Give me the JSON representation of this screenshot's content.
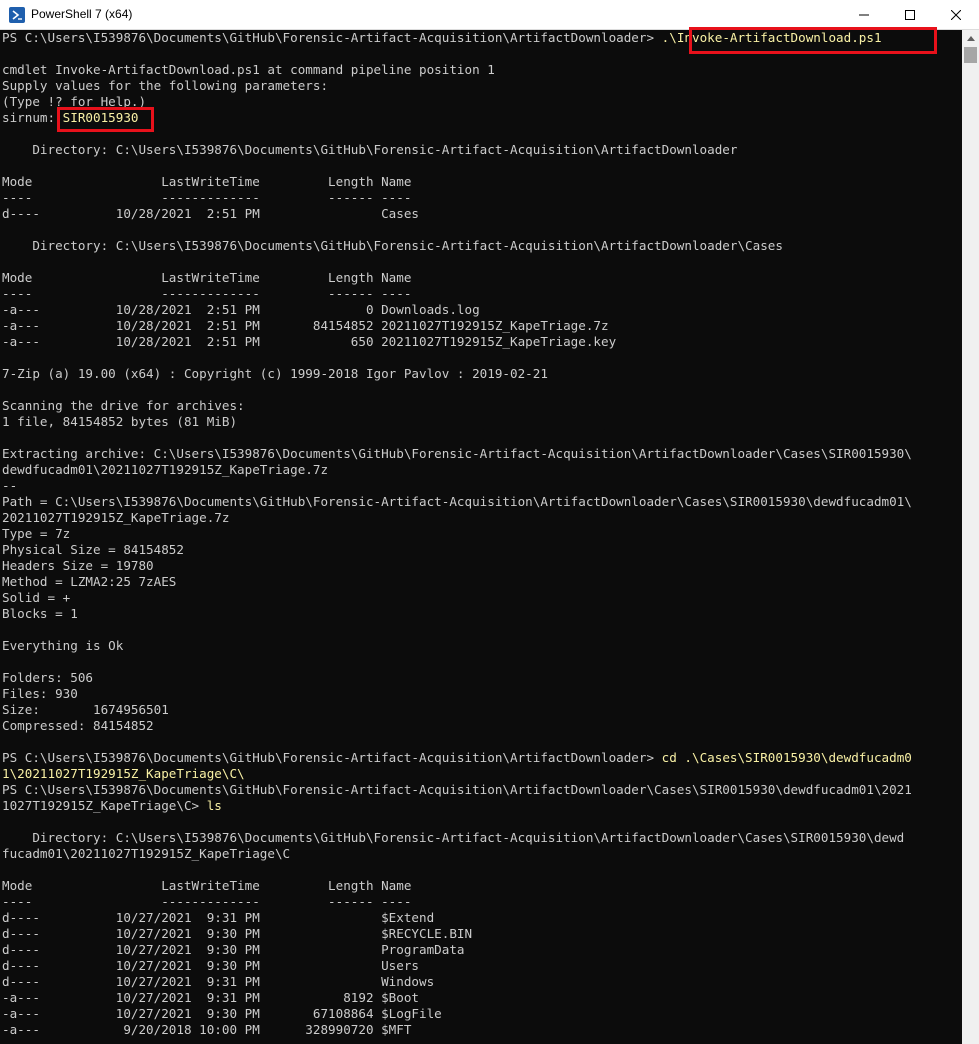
{
  "window": {
    "title": "PowerShell 7 (x64)",
    "icon": "powershell-icon",
    "controls": [
      "minimize-icon",
      "maximize-icon",
      "close-icon"
    ]
  },
  "colors": {
    "console_bg": "#0c0c0c",
    "console_fg": "#cccccc",
    "command_fg": "#f9f1a5",
    "highlight_box": "#e8111b"
  },
  "console": {
    "lines": [
      {
        "text": "PS C:\\Users\\I539876\\Documents\\GitHub\\Forensic-Artifact-Acquisition\\ArtifactDownloader> ",
        "cmd": ".\\Invoke-ArtifactDownload.ps1"
      },
      {
        "text": ""
      },
      {
        "text": "cmdlet Invoke-ArtifactDownload.ps1 at command pipeline position 1"
      },
      {
        "text": "Supply values for the following parameters:"
      },
      {
        "text": "(Type !? for Help.)"
      },
      {
        "text": "sirnum: ",
        "cmd": "SIR0015930"
      },
      {
        "text": ""
      },
      {
        "text": "    Directory: C:\\Users\\I539876\\Documents\\GitHub\\Forensic-Artifact-Acquisition\\ArtifactDownloader"
      },
      {
        "text": ""
      },
      {
        "text": "Mode                 LastWriteTime         Length Name"
      },
      {
        "text": "----                 -------------         ------ ----"
      },
      {
        "text": "d----          10/28/2021  2:51 PM                Cases"
      },
      {
        "text": ""
      },
      {
        "text": "    Directory: C:\\Users\\I539876\\Documents\\GitHub\\Forensic-Artifact-Acquisition\\ArtifactDownloader\\Cases"
      },
      {
        "text": ""
      },
      {
        "text": "Mode                 LastWriteTime         Length Name"
      },
      {
        "text": "----                 -------------         ------ ----"
      },
      {
        "text": "-a---          10/28/2021  2:51 PM              0 Downloads.log"
      },
      {
        "text": "-a---          10/28/2021  2:51 PM       84154852 20211027T192915Z_KapeTriage.7z"
      },
      {
        "text": "-a---          10/28/2021  2:51 PM            650 20211027T192915Z_KapeTriage.key"
      },
      {
        "text": ""
      },
      {
        "text": "7-Zip (a) 19.00 (x64) : Copyright (c) 1999-2018 Igor Pavlov : 2019-02-21"
      },
      {
        "text": ""
      },
      {
        "text": "Scanning the drive for archives:"
      },
      {
        "text": "1 file, 84154852 bytes (81 MiB)"
      },
      {
        "text": ""
      },
      {
        "text": "Extracting archive: C:\\Users\\I539876\\Documents\\GitHub\\Forensic-Artifact-Acquisition\\ArtifactDownloader\\Cases\\SIR0015930\\"
      },
      {
        "text": "dewdfucadm01\\20211027T192915Z_KapeTriage.7z"
      },
      {
        "text": "--"
      },
      {
        "text": "Path = C:\\Users\\I539876\\Documents\\GitHub\\Forensic-Artifact-Acquisition\\ArtifactDownloader\\Cases\\SIR0015930\\dewdfucadm01\\"
      },
      {
        "text": "20211027T192915Z_KapeTriage.7z"
      },
      {
        "text": "Type = 7z"
      },
      {
        "text": "Physical Size = 84154852"
      },
      {
        "text": "Headers Size = 19780"
      },
      {
        "text": "Method = LZMA2:25 7zAES"
      },
      {
        "text": "Solid = +"
      },
      {
        "text": "Blocks = 1"
      },
      {
        "text": ""
      },
      {
        "text": "Everything is Ok"
      },
      {
        "text": ""
      },
      {
        "text": "Folders: 506"
      },
      {
        "text": "Files: 930"
      },
      {
        "text": "Size:       1674956501"
      },
      {
        "text": "Compressed: 84154852"
      },
      {
        "text": ""
      },
      {
        "text": "PS C:\\Users\\I539876\\Documents\\GitHub\\Forensic-Artifact-Acquisition\\ArtifactDownloader> ",
        "cmd": "cd .\\Cases\\SIR0015930\\dewdfucadm0"
      },
      {
        "text": "",
        "cmd": "1\\20211027T192915Z_KapeTriage\\C\\"
      },
      {
        "text": "PS C:\\Users\\I539876\\Documents\\GitHub\\Forensic-Artifact-Acquisition\\ArtifactDownloader\\Cases\\SIR0015930\\dewdfucadm01\\2021"
      },
      {
        "text": "1027T192915Z_KapeTriage\\C> ",
        "cmd": "ls"
      },
      {
        "text": ""
      },
      {
        "text": "    Directory: C:\\Users\\I539876\\Documents\\GitHub\\Forensic-Artifact-Acquisition\\ArtifactDownloader\\Cases\\SIR0015930\\dewd"
      },
      {
        "text": "fucadm01\\20211027T192915Z_KapeTriage\\C"
      },
      {
        "text": ""
      },
      {
        "text": "Mode                 LastWriteTime         Length Name"
      },
      {
        "text": "----                 -------------         ------ ----"
      },
      {
        "text": "d----          10/27/2021  9:31 PM                $Extend"
      },
      {
        "text": "d----          10/27/2021  9:30 PM                $RECYCLE.BIN"
      },
      {
        "text": "d----          10/27/2021  9:30 PM                ProgramData"
      },
      {
        "text": "d----          10/27/2021  9:30 PM                Users"
      },
      {
        "text": "d----          10/27/2021  9:31 PM                Windows"
      },
      {
        "text": "-a---          10/27/2021  9:31 PM           8192 $Boot"
      },
      {
        "text": "-a---          10/27/2021  9:30 PM       67108864 $LogFile"
      },
      {
        "text": "-a---           9/20/2018 10:00 PM      328990720 $MFT"
      }
    ]
  }
}
